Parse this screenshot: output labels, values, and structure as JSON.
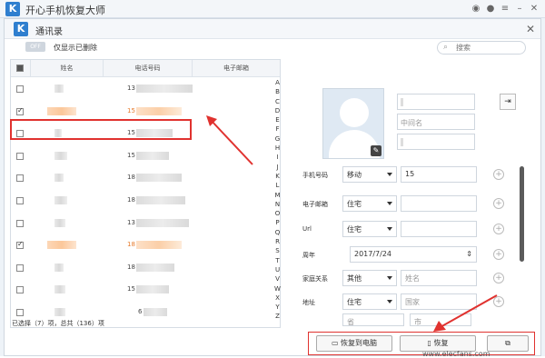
{
  "app": {
    "title": "开心手机恢复大师",
    "logo": "K"
  },
  "dialog": {
    "title": "通讯录",
    "logo": "K",
    "toggle_label": "OFF",
    "only_deleted_label": "仅显示已删除",
    "search_placeholder": "搜索"
  },
  "table": {
    "headers": {
      "name": "姓名",
      "phone": "电话号码",
      "email": "电子邮箱"
    },
    "rows": [
      {
        "checked": false,
        "prefix": "13",
        "highlight": false
      },
      {
        "checked": true,
        "prefix": "15",
        "highlight": true
      },
      {
        "checked": false,
        "prefix": "15",
        "highlight": false
      },
      {
        "checked": false,
        "prefix": "15",
        "highlight": false
      },
      {
        "checked": false,
        "prefix": "18",
        "highlight": false
      },
      {
        "checked": false,
        "prefix": "18",
        "highlight": false
      },
      {
        "checked": false,
        "prefix": "13",
        "highlight": false
      },
      {
        "checked": true,
        "prefix": "18",
        "highlight": true
      },
      {
        "checked": false,
        "prefix": "18",
        "highlight": false
      },
      {
        "checked": false,
        "prefix": "15",
        "highlight": false
      },
      {
        "checked": false,
        "prefix": "6",
        "highlight": false
      }
    ],
    "letters": [
      "A",
      "B",
      "C",
      "D",
      "E",
      "F",
      "G",
      "H",
      "I",
      "J",
      "K",
      "L",
      "M",
      "N",
      "O",
      "P",
      "Q",
      "R",
      "S",
      "T",
      "U",
      "V",
      "W",
      "X",
      "Y",
      "Z"
    ],
    "status": "已选择（7）项，总共（136）项"
  },
  "detail": {
    "middle_name_placeholder": "中间名",
    "fields": [
      {
        "label": "手机号码",
        "type": "移动",
        "value": "15"
      },
      {
        "label": "电子邮箱",
        "type": "住宅",
        "value": ""
      },
      {
        "label": "Url",
        "type": "住宅",
        "value": ""
      },
      {
        "label": "周年",
        "type": "",
        "value": "2017/7/24"
      },
      {
        "label": "家庭关系",
        "type": "其他",
        "value": "姓名"
      },
      {
        "label": "地址",
        "type": "住宅",
        "value": "国家"
      }
    ],
    "address_extra": [
      "省",
      "市"
    ]
  },
  "buttons": {
    "restore_to_pc": "恢复到电脑",
    "restore_to_device": "恢复"
  },
  "watermark": "www.elecfans.com"
}
